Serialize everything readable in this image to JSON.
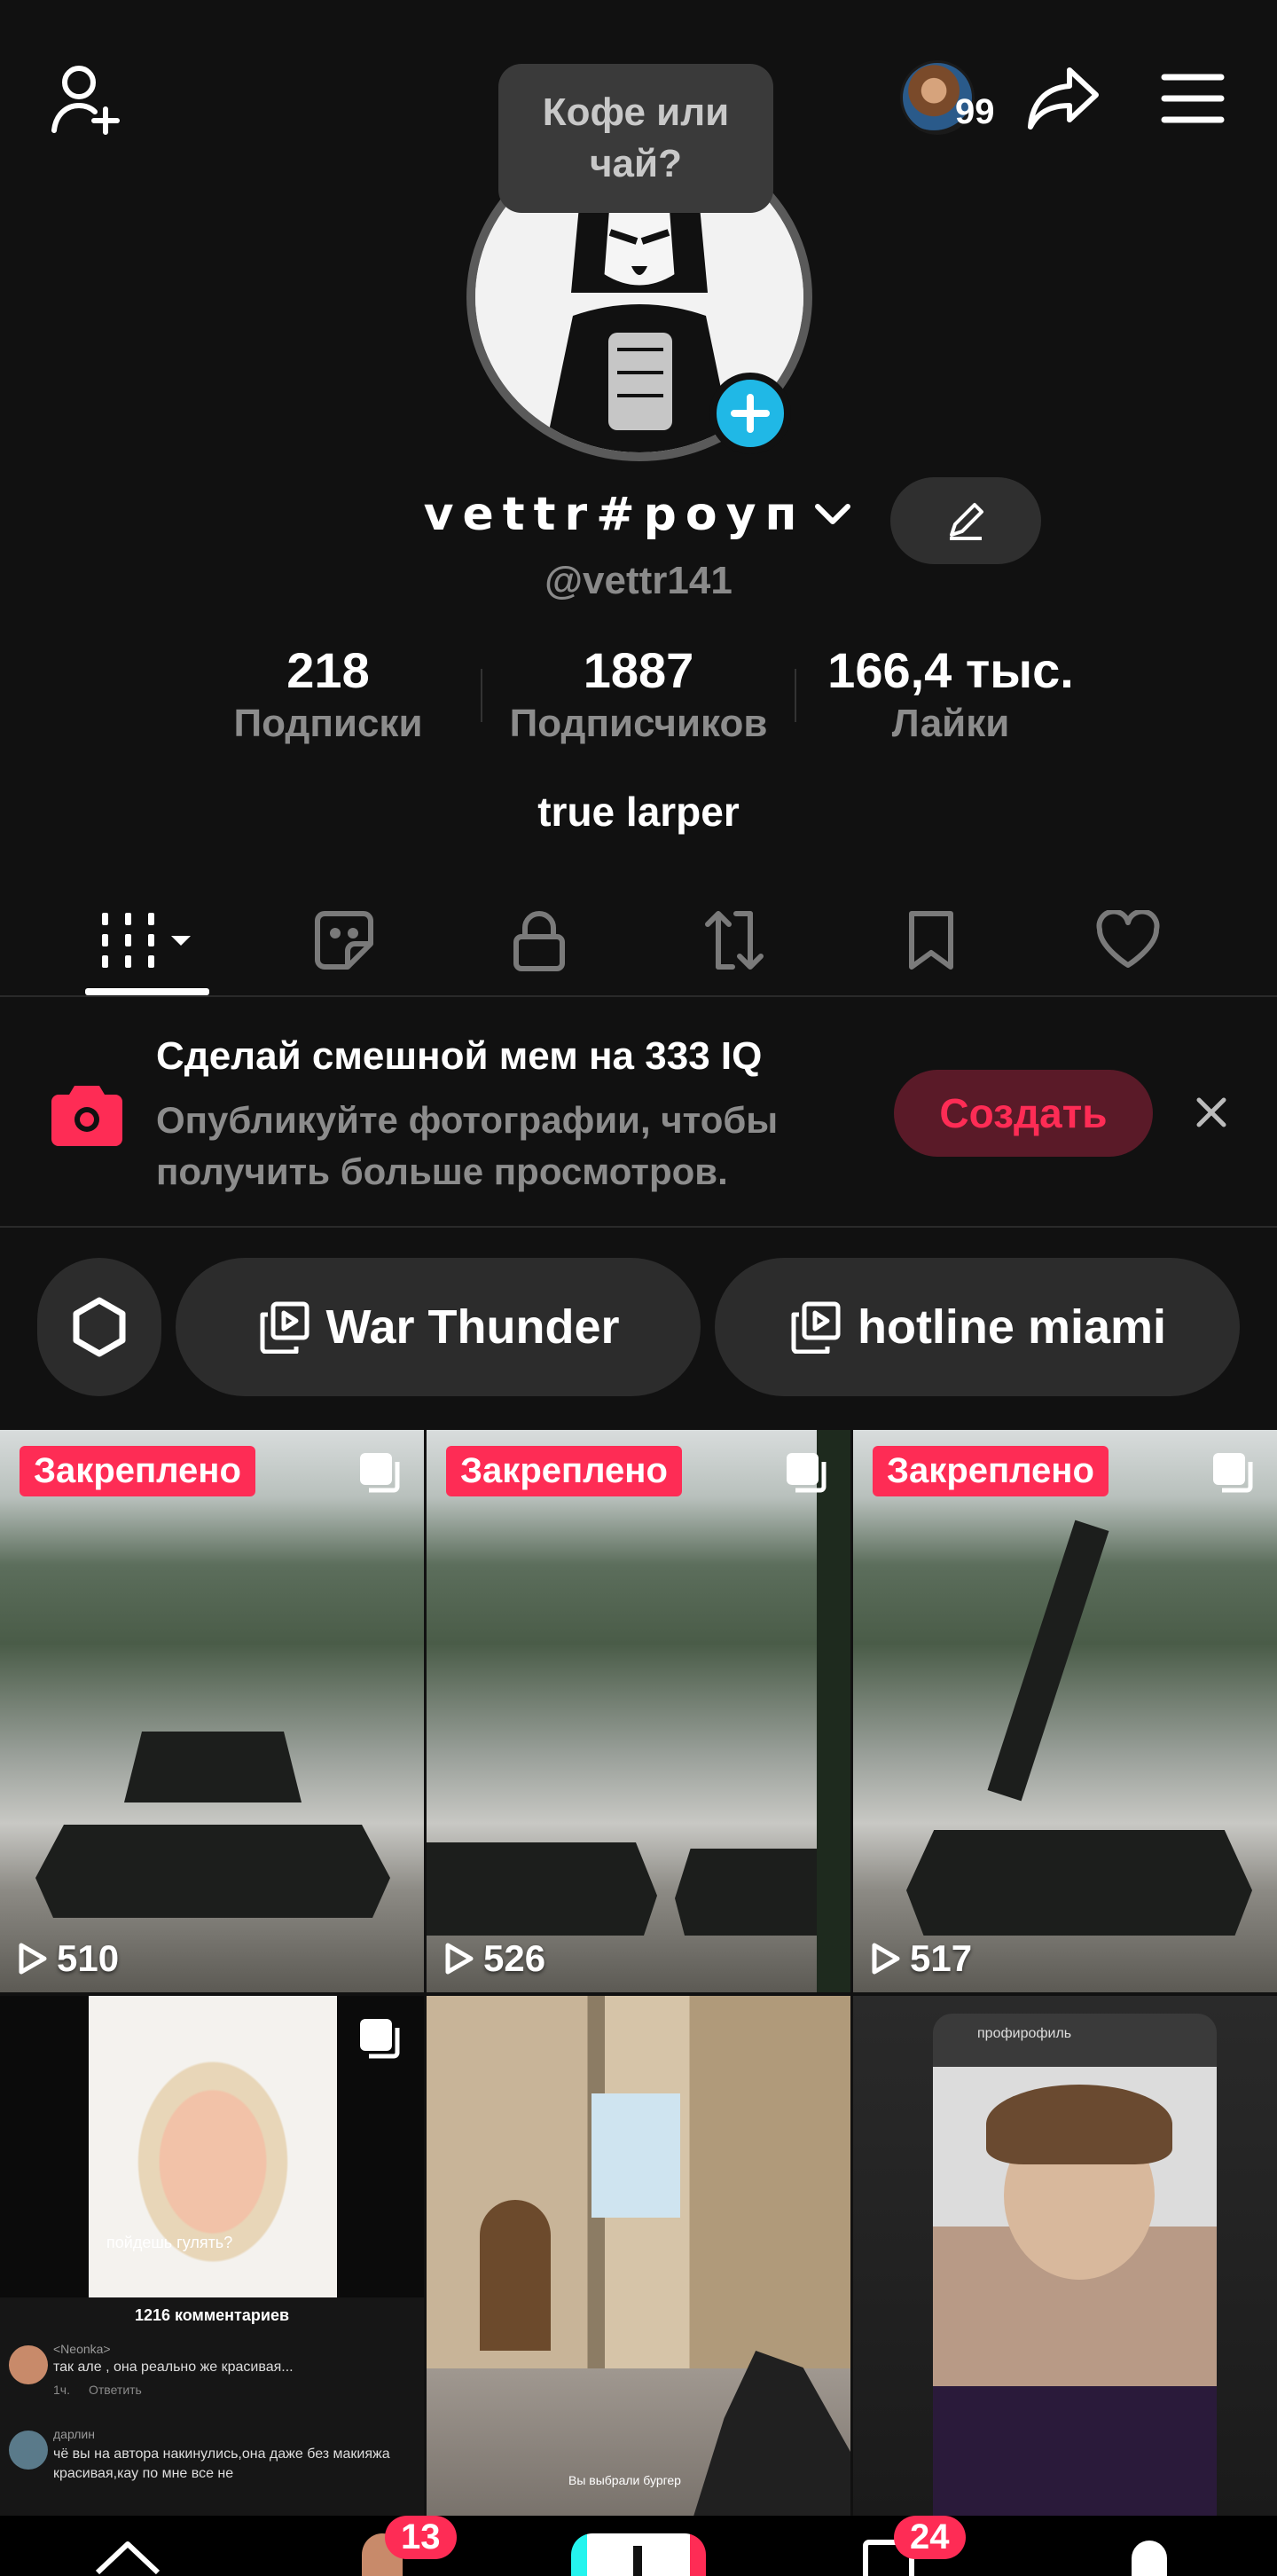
{
  "header": {
    "note_text": "Кофе или чай?",
    "story_count": "99"
  },
  "profile": {
    "display_name": "vettr#роуп",
    "handle": "@vettr141",
    "bio": "true larper"
  },
  "stats": [
    {
      "value": "218",
      "label": "Подписки"
    },
    {
      "value": "1887",
      "label": "Подписчиков"
    },
    {
      "value": "166,4 тыс.",
      "label": "Лайки"
    }
  ],
  "tabs": [
    "videos-grid",
    "stickers",
    "private",
    "reposts",
    "favorites",
    "liked"
  ],
  "promo": {
    "title": "Сделай смешной мем на 333 IQ",
    "subtitle": "Опубликуйте фотографии, чтобы получить больше просмотров.",
    "button": "Создать"
  },
  "playlists": [
    {
      "label": "War Thunder"
    },
    {
      "label": "hotline miami"
    }
  ],
  "videos": [
    {
      "pinned": "Закреплено",
      "views": "510"
    },
    {
      "pinned": "Закреплено",
      "views": "526"
    },
    {
      "pinned": "Закреплено",
      "views": "517"
    },
    {
      "comments_header": "1216 комментариев",
      "comment_user": "<Neonka>",
      "comment_text": "так але , она реально же красивая...",
      "comment_meta": "1ч.",
      "reply": "Ответить",
      "comment_user2": "дарлин",
      "comment_text2": "чё вы на автора накинулись,она даже без макияжа красивая,кау по мне все не",
      "caption": "пойдешь гулять?"
    },
    {
      "caption": "Вы выбрали бургер"
    },
    {
      "caption": "профирофиль"
    }
  ],
  "nav": {
    "inbox_badge": "13",
    "messages_badge": "24"
  },
  "colors": {
    "accent": "#fe2c55",
    "plus_blue": "#20b8e6",
    "background": "#111111"
  }
}
